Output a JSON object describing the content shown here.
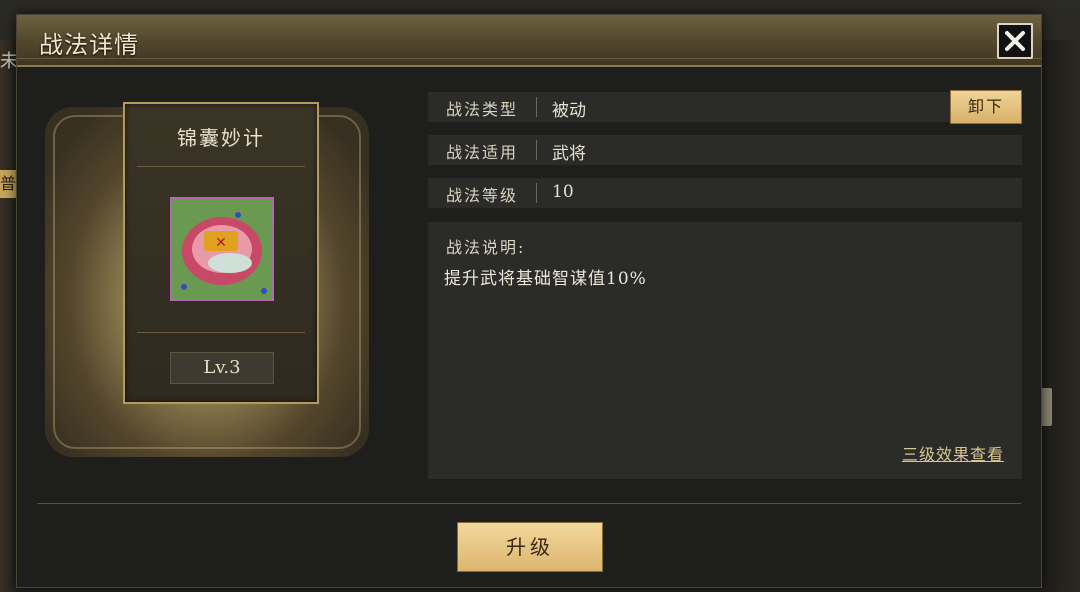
{
  "dialog": {
    "title": "战法详情",
    "close_icon": "close-icon"
  },
  "background": {
    "left_glyph": "未",
    "left_tab": "普"
  },
  "skill": {
    "name": "锦囊妙计",
    "icon": "silk-pouch-icon",
    "level": "Lv.3"
  },
  "info": {
    "type_label": "战法类型",
    "type_value": "被动",
    "unload_label": "卸下",
    "target_label": "战法适用",
    "target_value": "武将",
    "grade_label": "战法等级",
    "grade_value": "10"
  },
  "description": {
    "title": "战法说明:",
    "text": "提升武将基础智谋值10%",
    "link": "三级效果查看"
  },
  "actions": {
    "upgrade_label": "升级"
  },
  "colors": {
    "accent_gold": "#dcb56d",
    "panel_bg": "#2b2b29",
    "title_bar": "#564b30"
  }
}
